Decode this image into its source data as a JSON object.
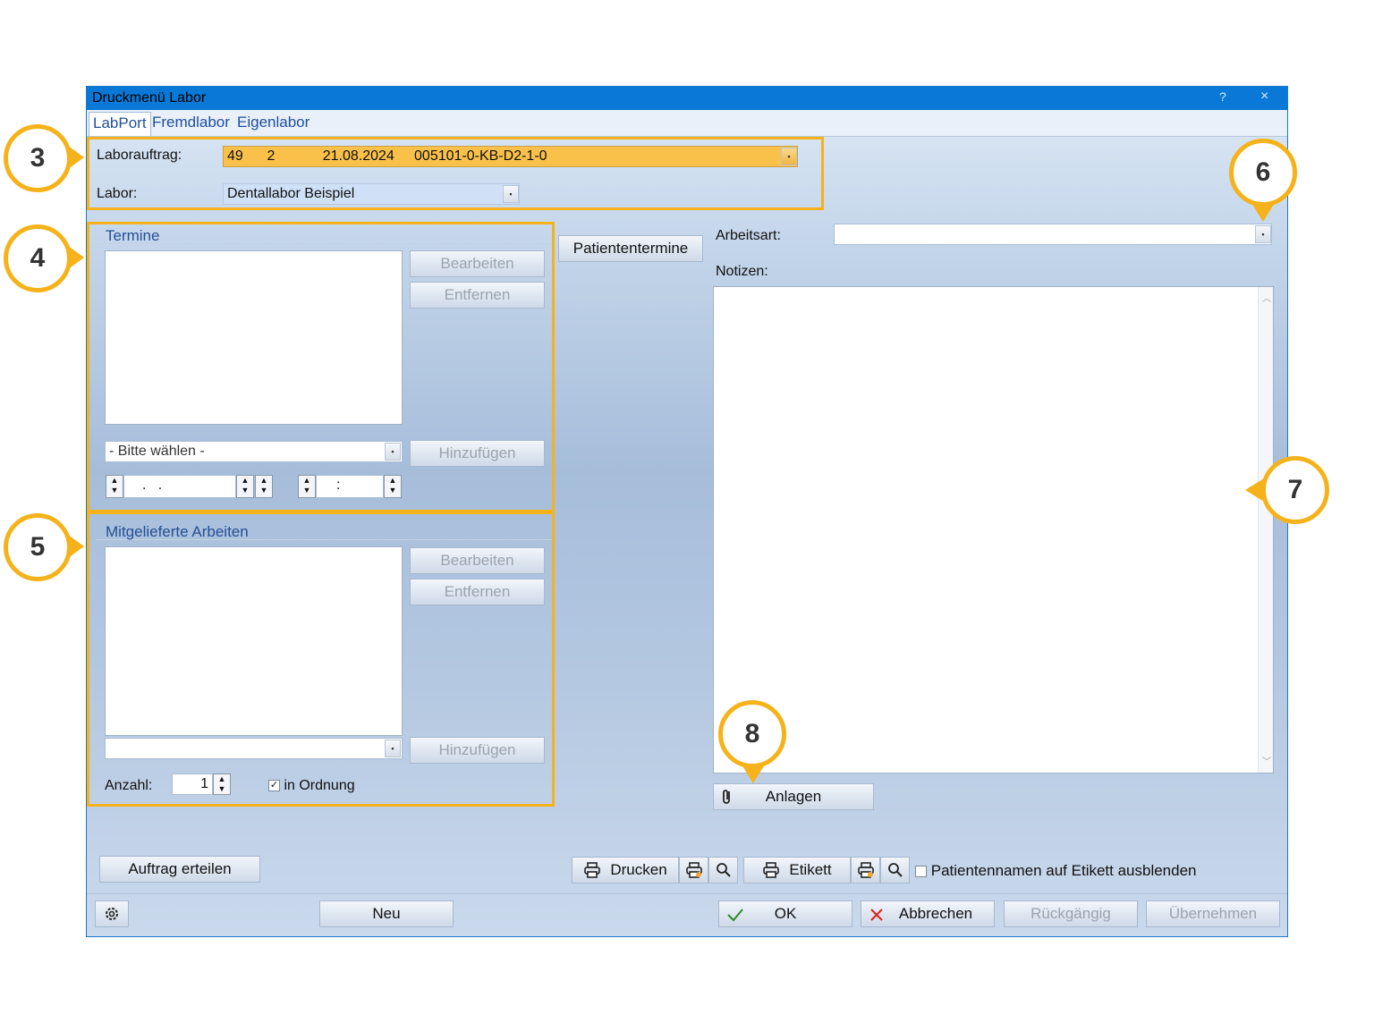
{
  "window": {
    "title": "Druckmenü Labor",
    "help_glyph": "?",
    "close_glyph": "×"
  },
  "tabs": [
    "LabPort",
    "Fremdlabor",
    "Eigenlabor"
  ],
  "order": {
    "laborauftrag_label": "Laborauftrag:",
    "laborauftrag_value": "49      2            21.08.2024     005101-0-KB-D2-1-0",
    "labor_label": "Labor:",
    "labor_value": "Dentallabor Beispiel"
  },
  "termine": {
    "group_label": "Termine",
    "edit_button": "Bearbeiten",
    "remove_button": "Entfernen",
    "select_placeholder": "- Bitte wählen -",
    "add_button": "Hinzufügen",
    "date_value": ".   .",
    "time_value": ":"
  },
  "patiententermine_button": "Patiententermine",
  "arbeitsart_label": "Arbeitsart:",
  "notizen_label": "Notizen:",
  "arbeiten": {
    "group_label": "Mitgelieferte Arbeiten",
    "edit_button": "Bearbeiten",
    "remove_button": "Entfernen",
    "add_button": "Hinzufügen",
    "anzahl_label": "Anzahl:",
    "anzahl_value": "1",
    "in_ordnung_label": "in Ordnung",
    "in_ordnung_checked": "✓"
  },
  "anlagen_button": "Anlagen",
  "bottom": {
    "auftrag_button": "Auftrag erteilen",
    "drucken_button": "Drucken",
    "etikett_button": "Etikett",
    "hide_names_label": "Patientennamen auf Etikett ausblenden",
    "neu_button": "Neu",
    "ok_button": "OK",
    "abbrechen_button": "Abbrechen",
    "rueckgaengig_button": "Rückgängig",
    "uebernehmen_button": "Übernehmen"
  },
  "callouts": [
    "3",
    "4",
    "5",
    "6",
    "7",
    "8"
  ],
  "colors": {
    "accent_orange": "#f5b21a",
    "title_blue": "#0a78d7",
    "order_field": "#f9c14a",
    "labor_field": "#cfe0f7"
  }
}
